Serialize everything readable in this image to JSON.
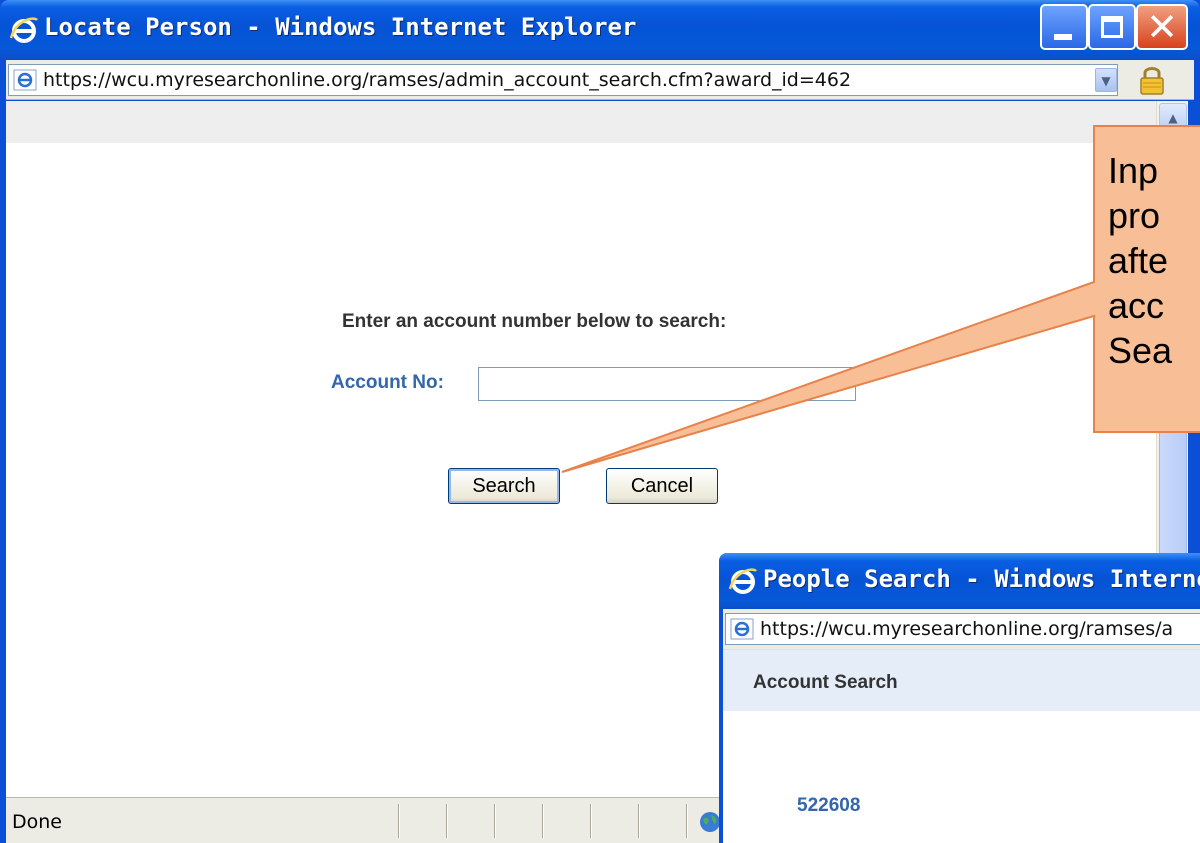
{
  "window1": {
    "title": "Locate Person - Windows Internet Explorer",
    "url": "https://wcu.myresearchonline.org/ramses/admin_account_search.cfm?award_id=462",
    "page": {
      "prompt": "Enter an account number below to search:",
      "account_label": "Account No:",
      "account_value": "",
      "search_label": "Search",
      "cancel_label": "Cancel"
    },
    "status": "Done"
  },
  "window2": {
    "title": "People Search - Windows Internet E",
    "url": "https://wcu.myresearchonline.org/ramses/a",
    "section_title": "Account Search",
    "results": [
      "522608"
    ]
  },
  "callout": {
    "lines": [
      "Inp",
      "pro",
      "afte",
      "acc",
      "Sea"
    ],
    "fill": "#f8be95",
    "stroke": "#e8824a"
  },
  "colors": {
    "titlebar": "#0653d6",
    "label_blue": "#3366aa"
  }
}
